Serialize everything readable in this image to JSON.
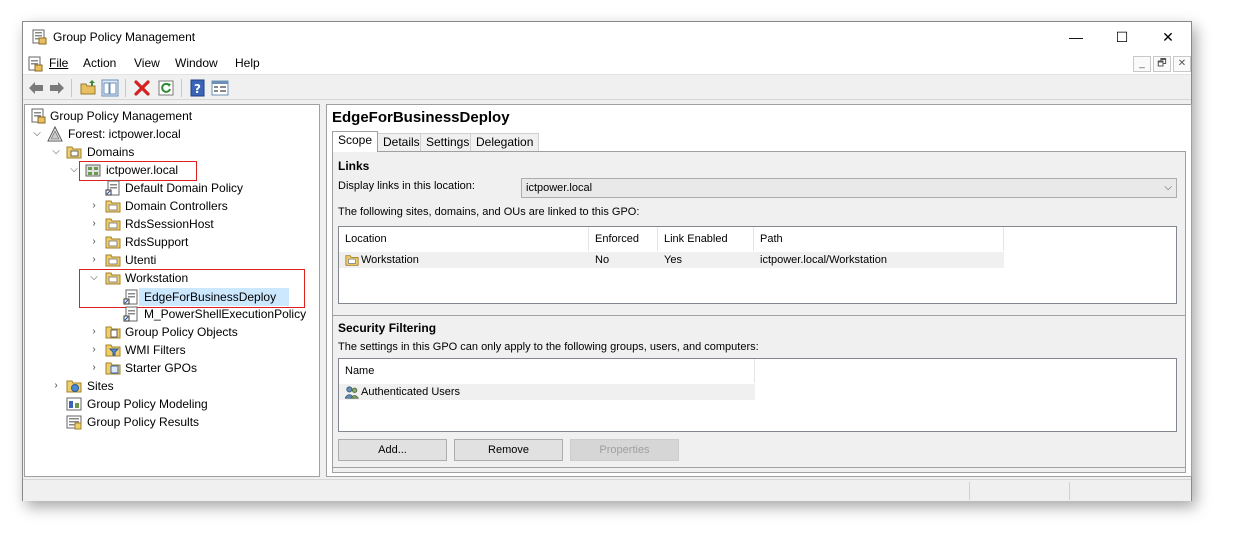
{
  "window": {
    "title": "Group Policy Management",
    "controls": {
      "minimize": "—",
      "maximize": "☐",
      "close": "✕"
    }
  },
  "menu": {
    "items": [
      "File",
      "Action",
      "View",
      "Window",
      "Help"
    ],
    "mdi_controls": {
      "minimize": "_",
      "restore": "🗗",
      "close": "✕"
    }
  },
  "toolbar": {
    "buttons": [
      "back-icon",
      "forward-icon",
      "up-folder-icon",
      "show-hide-tree-icon",
      "delete-icon",
      "refresh-icon",
      "help-icon",
      "properties-icon"
    ]
  },
  "tree": {
    "root": "Group Policy Management",
    "forest": "Forest: ictpower.local",
    "domains": "Domains",
    "domain": "ictpower.local",
    "default_domain_policy": "Default Domain Policy",
    "domain_controllers": "Domain Controllers",
    "rds_session_host": "RdsSessionHost",
    "rds_support": "RdsSupport",
    "utenti": "Utenti",
    "workstation": "Workstation",
    "edge_gpo": "EdgeForBusinessDeploy",
    "powershell_gpo": "M_PowerShellExecutionPolicy",
    "gpo_objects": "Group Policy Objects",
    "wmi_filters": "WMI Filters",
    "starter_gpos": "Starter GPOs",
    "sites": "Sites",
    "modeling": "Group Policy Modeling",
    "results": "Group Policy Results"
  },
  "detail": {
    "title": "EdgeForBusinessDeploy",
    "tabs": [
      "Scope",
      "Details",
      "Settings",
      "Delegation"
    ],
    "links": {
      "heading": "Links",
      "display_label": "Display links in this location:",
      "location_value": "ictpower.local",
      "linked_text": "The following sites, domains, and OUs are linked to this GPO:",
      "columns": [
        "Location",
        "Enforced",
        "Link Enabled",
        "Path"
      ],
      "rows": [
        {
          "location": "Workstation",
          "enforced": "No",
          "link_enabled": "Yes",
          "path": "ictpower.local/Workstation"
        }
      ]
    },
    "security": {
      "heading": "Security Filtering",
      "desc": "The settings in this GPO can only apply to the following groups, users, and computers:",
      "column": "Name",
      "rows": [
        "Authenticated Users"
      ],
      "buttons": {
        "add": "Add...",
        "remove": "Remove",
        "properties": "Properties"
      }
    }
  }
}
